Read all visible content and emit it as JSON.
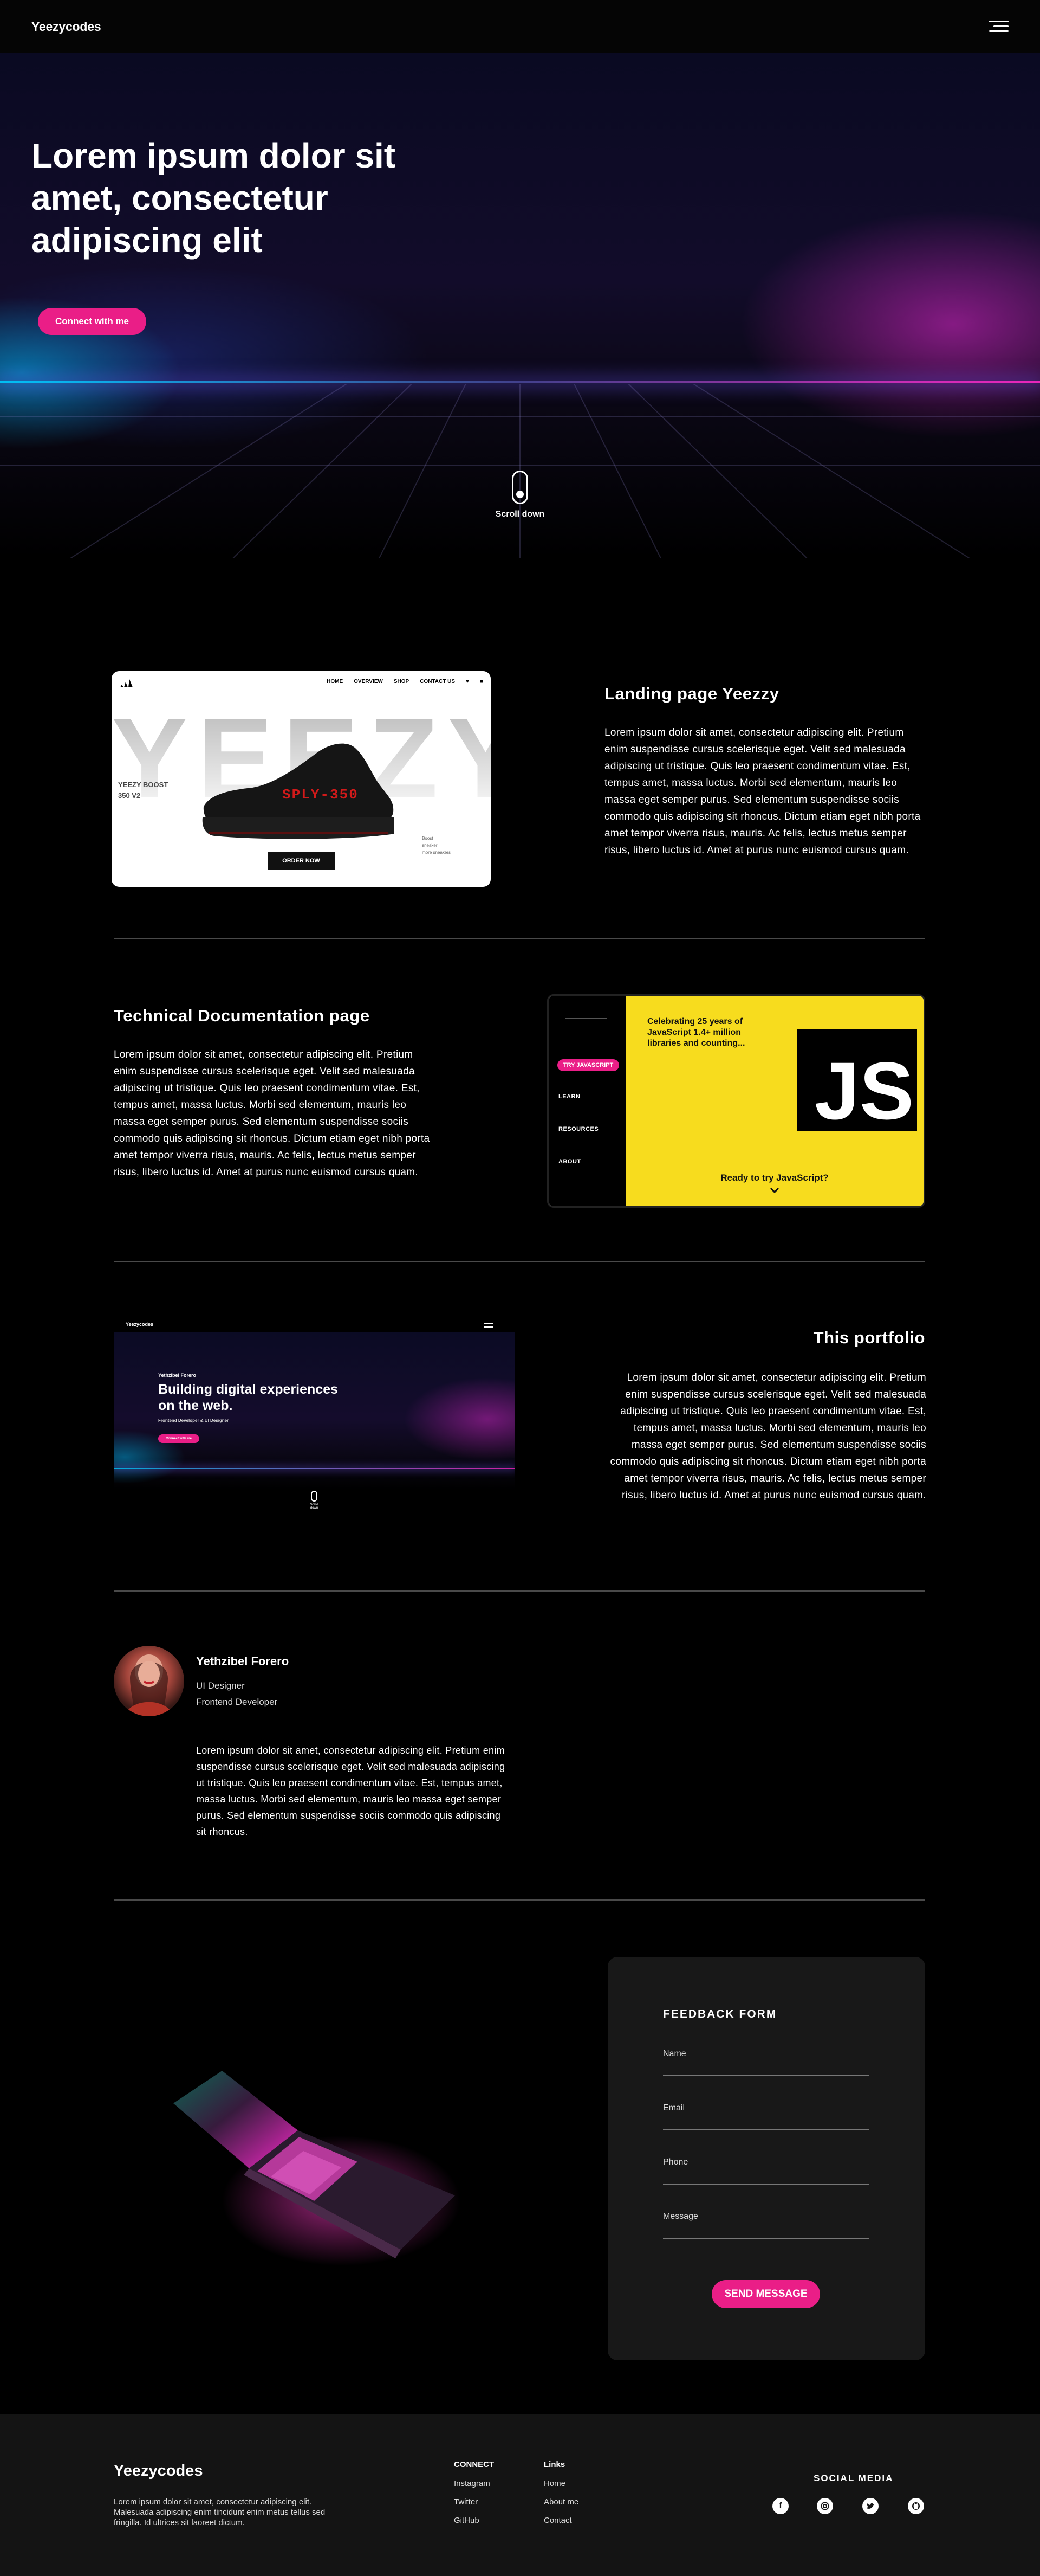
{
  "nav": {
    "brand": "Yeezycodes",
    "menu_icon": "hamburger-menu-icon"
  },
  "hero": {
    "title": "Lorem ipsum dolor sit amet, consectetur adipiscing elit",
    "cta": "Connect with me",
    "scroll_label": "Scroll down"
  },
  "projects": [
    {
      "title": "Landing page Yeezzy",
      "description": "Lorem ipsum dolor sit amet, consectetur adipiscing elit. Pretium enim suspendisse cursus scelerisque eget. Velit sed malesuada adipiscing ut tristique. Quis leo praesent condimentum vitae. Est, tempus amet, massa luctus. Morbi sed elementum, mauris leo massa eget semper purus. Sed elementum suspendisse sociis commodo quis adipiscing sit rhoncus. Dictum etiam eget nibh porta amet tempor viverra risus, mauris. Ac felis, lectus metus semper risus, libero luctus id. Amet at purus nunc euismod cursus quam."
    },
    {
      "title": "Technical Documentation page",
      "description": "Lorem ipsum dolor sit amet, consectetur adipiscing elit. Pretium enim suspendisse cursus scelerisque eget. Velit sed malesuada adipiscing ut tristique. Quis leo praesent condimentum vitae. Est, tempus amet, massa luctus. Morbi sed elementum, mauris leo massa eget semper purus. Sed elementum suspendisse sociis commodo quis adipiscing sit rhoncus. Dictum etiam eget nibh porta amet tempor viverra risus, mauris. Ac felis, lectus metus semper risus, libero luctus id. Amet at purus nunc euismod cursus quam."
    },
    {
      "title": "This portfolio",
      "description": "Lorem ipsum dolor sit amet, consectetur adipiscing elit. Pretium enim suspendisse cursus scelerisque eget. Velit sed malesuada adipiscing ut tristique. Quis leo praesent condimentum vitae. Est, tempus amet, massa luctus. Morbi sed elementum, mauris leo massa eget semper purus. Sed elementum suspendisse sociis commodo quis adipiscing sit rhoncus. Dictum etiam eget nibh porta amet tempor viverra risus, mauris. Ac felis, lectus metus semper risus, libero luctus id. Amet at purus nunc euismod cursus quam."
    }
  ],
  "shot_yeezy": {
    "nav": [
      "HOME",
      "OVERVIEW",
      "SHOP",
      "CONTACT US"
    ],
    "bg_word": "YEEZY",
    "tag_line1": "YEEZY BOOST",
    "tag_line2": "350 V2",
    "shoe_text": "SPLY-350",
    "order": "ORDER NOW",
    "small_line1": "Boost",
    "small_line2": "sneaker",
    "small_line3": "more sneakers"
  },
  "shot_js": {
    "menu": [
      "TRY JAVASCRIPT",
      "LEARN",
      "RESOURCES",
      "ABOUT"
    ],
    "heading": "Celebrating 25 years of JavaScript 1.4+ million libraries and counting...",
    "logo": "JS",
    "ready": "Ready to try JavaScript?"
  },
  "shot_portfolio": {
    "brand": "Yeezycodes",
    "name": "Yethzibel Forero",
    "title": "Building digital experiences on the web.",
    "subtitle": "Frontend Developer & UI Designer",
    "cta": "Connect with me",
    "scroll": "Scroll down"
  },
  "about": {
    "name": "Yethzibel Forero",
    "role1": "UI Designer",
    "role2": "Frontend Developer",
    "bio": "Lorem ipsum dolor sit amet, consectetur adipiscing elit. Pretium enim suspendisse cursus scelerisque eget. Velit sed malesuada adipiscing ut tristique. Quis leo praesent condimentum vitae. Est, tempus amet, massa luctus. Morbi sed elementum, mauris leo massa eget semper purus. Sed elementum suspendisse sociis commodo quis adipiscing sit rhoncus."
  },
  "form": {
    "title": "FEEDBACK FORM",
    "fields": [
      "Name",
      "Email",
      "Phone",
      "Message"
    ],
    "submit": "SEND MESSAGE"
  },
  "footer": {
    "brand": "Yeezycodes",
    "description": "Lorem ipsum dolor sit amet, consectetur adipiscing elit. Malesuada adipiscing enim tincidunt enim metus tellus sed fringilla. Id ultrices sit laoreet dictum.",
    "connect_title": "CONNECT",
    "connect": [
      "Instagram",
      "Twitter",
      "GitHub"
    ],
    "links_title": "Links",
    "links": [
      "Home",
      "About me",
      "Contact"
    ],
    "social_title": "SOCIAL MEDIA",
    "social_icons": [
      "facebook-icon",
      "instagram-icon",
      "twitter-icon",
      "github-icon"
    ]
  },
  "colors": {
    "accent": "#ea1e87",
    "js_yellow": "#f7dc1e",
    "background": "#000000",
    "footer": "#141414"
  }
}
